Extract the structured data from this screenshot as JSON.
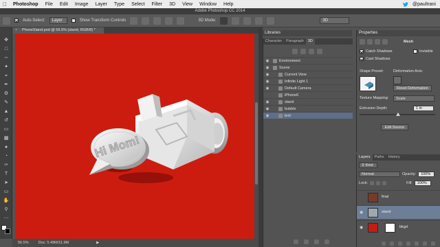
{
  "menubar": {
    "app": "Photoshop",
    "items": [
      "File",
      "Edit",
      "Image",
      "Layer",
      "Type",
      "Select",
      "Filter",
      "3D",
      "View",
      "Window",
      "Help"
    ],
    "user": "@paultrani"
  },
  "window_title": "Adobe Photoshop CC 2014",
  "options": {
    "auto_select_label": "Auto-Select:",
    "auto_select_value": "Layer",
    "show_transform_label": "Show Transform Controls",
    "mode_label": "3D Mode:",
    "workspace": "3D"
  },
  "document": {
    "tab_label": "PhoneStand.psd @ 56.5% (stand, RGB/8) *",
    "zoom": "56.5%",
    "doc_info": "Doc: 5.49M/11.9M",
    "canvas_color": "#cc1c10",
    "bubble_text": "Hi Mom!"
  },
  "libraries": {
    "title": "Libraries"
  },
  "panel3d": {
    "tabs": [
      "Character",
      "Paragraph",
      "3D"
    ],
    "active_tab": "3D",
    "scene_items": [
      {
        "label": "Environment",
        "indent": 0,
        "visible": true,
        "selected": false
      },
      {
        "label": "Scene",
        "indent": 0,
        "visible": true,
        "selected": false
      },
      {
        "label": "Current View",
        "indent": 1,
        "visible": true,
        "selected": false
      },
      {
        "label": "Infinite Light 1",
        "indent": 1,
        "visible": true,
        "selected": false
      },
      {
        "label": "Default Camera",
        "indent": 1,
        "visible": true,
        "selected": false
      },
      {
        "label": "iPhone6",
        "indent": 1,
        "visible": false,
        "selected": false
      },
      {
        "label": "stand",
        "indent": 1,
        "visible": true,
        "selected": false
      },
      {
        "label": "bubble",
        "indent": 1,
        "visible": true,
        "selected": false
      },
      {
        "label": "text",
        "indent": 1,
        "visible": true,
        "selected": true
      }
    ]
  },
  "properties": {
    "title": "Properties",
    "mode": "Mesh",
    "catch_shadows": "Catch Shadows",
    "cast_shadows": "Cast Shadows",
    "invisible": "Invisible",
    "shape_preset": "Shape Preset:",
    "deformation_axis": "Deformation Axis:",
    "reset_deformation": "Reset Deformation",
    "texture_mapping_label": "Texture Mapping:",
    "texture_mapping_value": "Scale",
    "extrusion_label": "Extrusion Depth:",
    "extrusion_value": "1 in",
    "edit_source": "Edit Source"
  },
  "layers": {
    "tabs": [
      "Layers",
      "Paths",
      "History"
    ],
    "active_tab": "Layers",
    "filter": "Kind",
    "blend_mode": "Normal",
    "opacity_label": "Opacity:",
    "opacity_value": "100%",
    "lock_label": "Lock:",
    "fill_label": "Fill:",
    "fill_value": "100%",
    "items": [
      {
        "name": "final",
        "visible": false,
        "selected": false,
        "thumb": "#7a3a2a"
      },
      {
        "name": "stand",
        "visible": true,
        "selected": true,
        "thumb": "#9fa7b0"
      },
      {
        "name": "bkgd",
        "visible": true,
        "selected": false,
        "thumb": "#c41c12"
      }
    ]
  }
}
